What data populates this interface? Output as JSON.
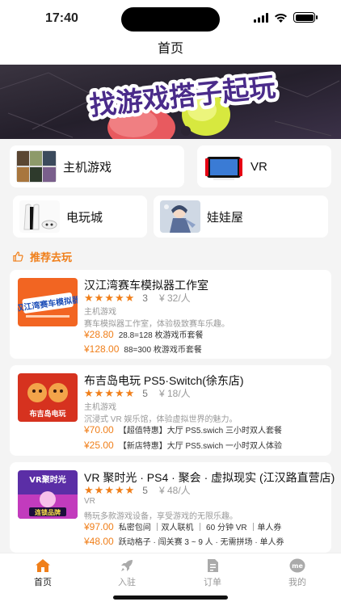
{
  "status_bar": {
    "time": "17:40"
  },
  "nav": {
    "title": "首页"
  },
  "banner": {
    "text": "找游戏搭子起玩"
  },
  "categories": [
    {
      "label": "主机游戏",
      "icon": "console-games-thumb"
    },
    {
      "label": "VR",
      "icon": "vr-headset-thumb"
    },
    {
      "label": "电玩城",
      "icon": "ps5-console-thumb"
    },
    {
      "label": "娃娃屋",
      "icon": "doll-house-thumb"
    }
  ],
  "section": {
    "title": "推荐去玩",
    "icon": "thumbs-up-icon"
  },
  "cards": [
    {
      "name": "汉江湾赛车模拟器工作室",
      "thumb_text": "汉江湾赛车模拟器",
      "rating_stars": 5,
      "score": "3",
      "price_per": "¥ 32/人",
      "type": "主机游戏",
      "desc": "赛车模拟器工作室，体验极致赛车乐趣。",
      "deals": [
        {
          "price": "¥28.80",
          "desc": "28.8=128 枚游戏币套餐"
        },
        {
          "price": "¥128.00",
          "desc": "88=300 枚游戏币套餐"
        }
      ]
    },
    {
      "name": "布吉岛电玩 PS5·Switch(徐东店)",
      "thumb_text": "布吉岛电玩",
      "rating_stars": 5,
      "score": "5",
      "price_per": "¥ 18/人",
      "type": "主机游戏",
      "desc": "沉浸式 VR 娱乐馆，体验虚拟世界的魅力。",
      "deals": [
        {
          "price": "¥70.00",
          "desc": "【超值特惠】大厅 PS5.swich 三小时双人套餐"
        },
        {
          "price": "¥25.00",
          "desc": "【新店特惠】大厅 PS5.swich 一小时双人体验"
        }
      ]
    },
    {
      "name": "VR 聚时光 · PS4 · 聚会 · 虚拟现实 (江汉路直营店)",
      "thumb_text_top": "VR聚时光",
      "thumb_text_bottom": "连锁品牌",
      "rating_stars": 5,
      "score": "5",
      "price_per": "¥ 48/人",
      "type": "VR",
      "desc": "畅玩多款游戏设备，享受游戏的无限乐趣。",
      "deals": [
        {
          "price": "¥97.00",
          "desc": "私密包间 ｜双人联机 ｜ 60 分钟 VR ｜单人券"
        },
        {
          "price": "¥48.00",
          "desc": "跃动格子 · 闯关赛 3 ~ 9 人 · 无需拼场 · 单人券"
        }
      ]
    }
  ],
  "tabs": [
    {
      "label": "首页",
      "icon": "home-icon",
      "active": true
    },
    {
      "label": "入驻",
      "icon": "rocket-icon",
      "active": false
    },
    {
      "label": "订单",
      "icon": "order-document-icon",
      "active": false
    },
    {
      "label": "我的",
      "icon": "me-profile-icon",
      "active": false
    }
  ],
  "colors": {
    "accent": "#f07f1a",
    "background": "#f4f4f4"
  }
}
